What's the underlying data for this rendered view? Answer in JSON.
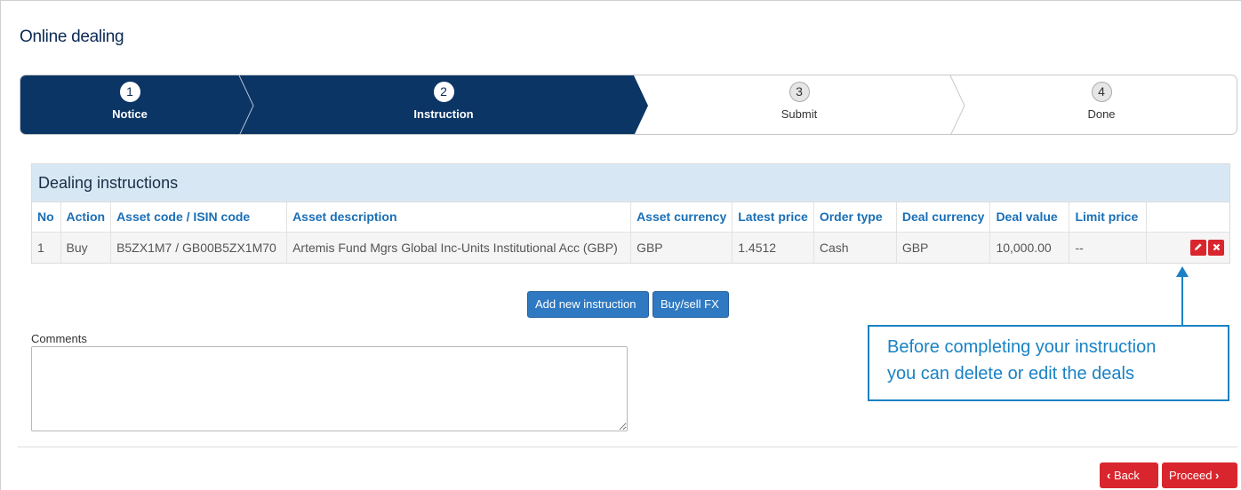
{
  "page": {
    "title": "Online dealing"
  },
  "stepper": {
    "steps": [
      {
        "number": "1",
        "label": "Notice",
        "state": "done"
      },
      {
        "number": "2",
        "label": "Instruction",
        "state": "active"
      },
      {
        "number": "3",
        "label": "Submit",
        "state": "todo"
      },
      {
        "number": "4",
        "label": "Done",
        "state": "todo"
      }
    ],
    "active_color": "#0b3565"
  },
  "instructions": {
    "title": "Dealing instructions",
    "columns": [
      "No",
      "Action",
      "Asset code / ISIN code",
      "Asset description",
      "Asset currency",
      "Latest price",
      "Order type",
      "Deal currency",
      "Deal value",
      "Limit price",
      ""
    ],
    "rows": [
      {
        "no": "1",
        "action": "Buy",
        "code": "B5ZX1M7 / GB00B5ZX1M70",
        "description": "Artemis Fund Mgrs Global Inc-Units Institutional Acc (GBP)",
        "asset_currency": "GBP",
        "latest_price": "1.4512",
        "order_type": "Cash",
        "deal_currency": "GBP",
        "deal_value": "10,000.00",
        "limit_price": "--",
        "edit_icon": "pencil-icon",
        "delete_icon": "close-icon"
      }
    ]
  },
  "actions": {
    "add_instruction": "Add new instruction",
    "buy_sell_fx": "Buy/sell FX"
  },
  "comments": {
    "label": "Comments",
    "value": ""
  },
  "footer": {
    "back": "Back",
    "proceed": "Proceed",
    "back_icon": "chevron-left-icon",
    "proceed_icon": "chevron-right-icon"
  },
  "callout": {
    "text_line1": "Before completing your instruction",
    "text_line2": "you can delete or edit the deals"
  },
  "colors": {
    "navy": "#0b3565",
    "link_blue": "#1a6fb6",
    "danger": "#d9262e",
    "header_bg": "#d7e8f4",
    "callout": "#1a82c4"
  }
}
